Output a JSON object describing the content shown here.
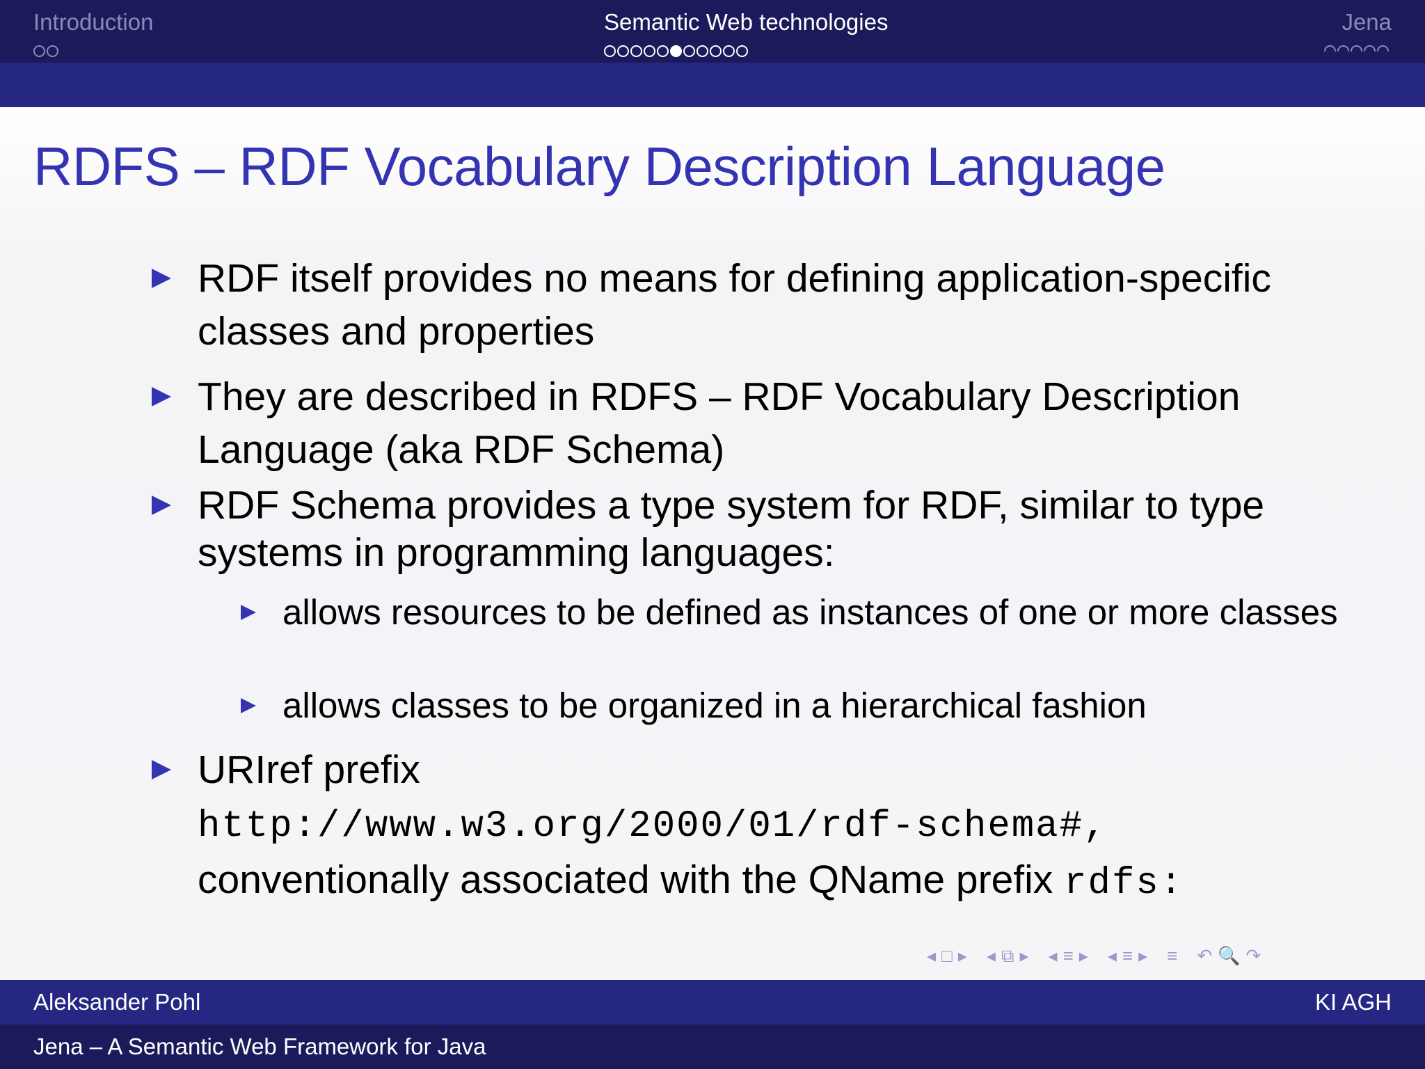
{
  "headline": {
    "sections": [
      {
        "title": "Introduction",
        "dot_count": 2,
        "current_dot": null,
        "active": false
      },
      {
        "title": "Semantic Web technologies",
        "dot_count": 11,
        "current_dot": 5,
        "active": true
      },
      {
        "title": "Jena",
        "dot_count": 5,
        "current_dot": null,
        "active": false
      }
    ]
  },
  "slide": {
    "title": "RDFS – RDF Vocabulary Description Language",
    "bullets": [
      {
        "text": "RDF itself provides no means for defining application-specific classes and properties"
      },
      {
        "text": "They are described in RDFS – RDF Vocabulary Description Language (aka RDF Schema)"
      },
      {
        "text": "RDF Schema provides a type system for RDF, similar to type systems in programming languages:"
      },
      {
        "text": "URIref prefix"
      }
    ],
    "subbullets": [
      {
        "text": "allows resources to be defined as instances of one or more classes"
      },
      {
        "text": "allows classes to be organized in a hierarchical fashion"
      }
    ],
    "uri": "http://www.w3.org/2000/01/rdf-schema#,",
    "qname_text": "conventionally associated with the QName prefix",
    "qname_prefix": "rdfs:"
  },
  "navigation": {
    "symbols": [
      "◂",
      "□",
      "▸",
      "◂",
      "⧉",
      "▸",
      "◂",
      "≡",
      "▸",
      "◂",
      "≡",
      "▸",
      "≡",
      "↶",
      "🔍",
      "↷"
    ]
  },
  "footer": {
    "author": "Aleksander Pohl",
    "institute": "KI AGH",
    "presentation_title": "Jena – A Semantic Web Framework for Java"
  },
  "colors": {
    "headline_bg": "#1b1b5c",
    "subhead_bg": "#262683",
    "accent": "#3434b2"
  }
}
